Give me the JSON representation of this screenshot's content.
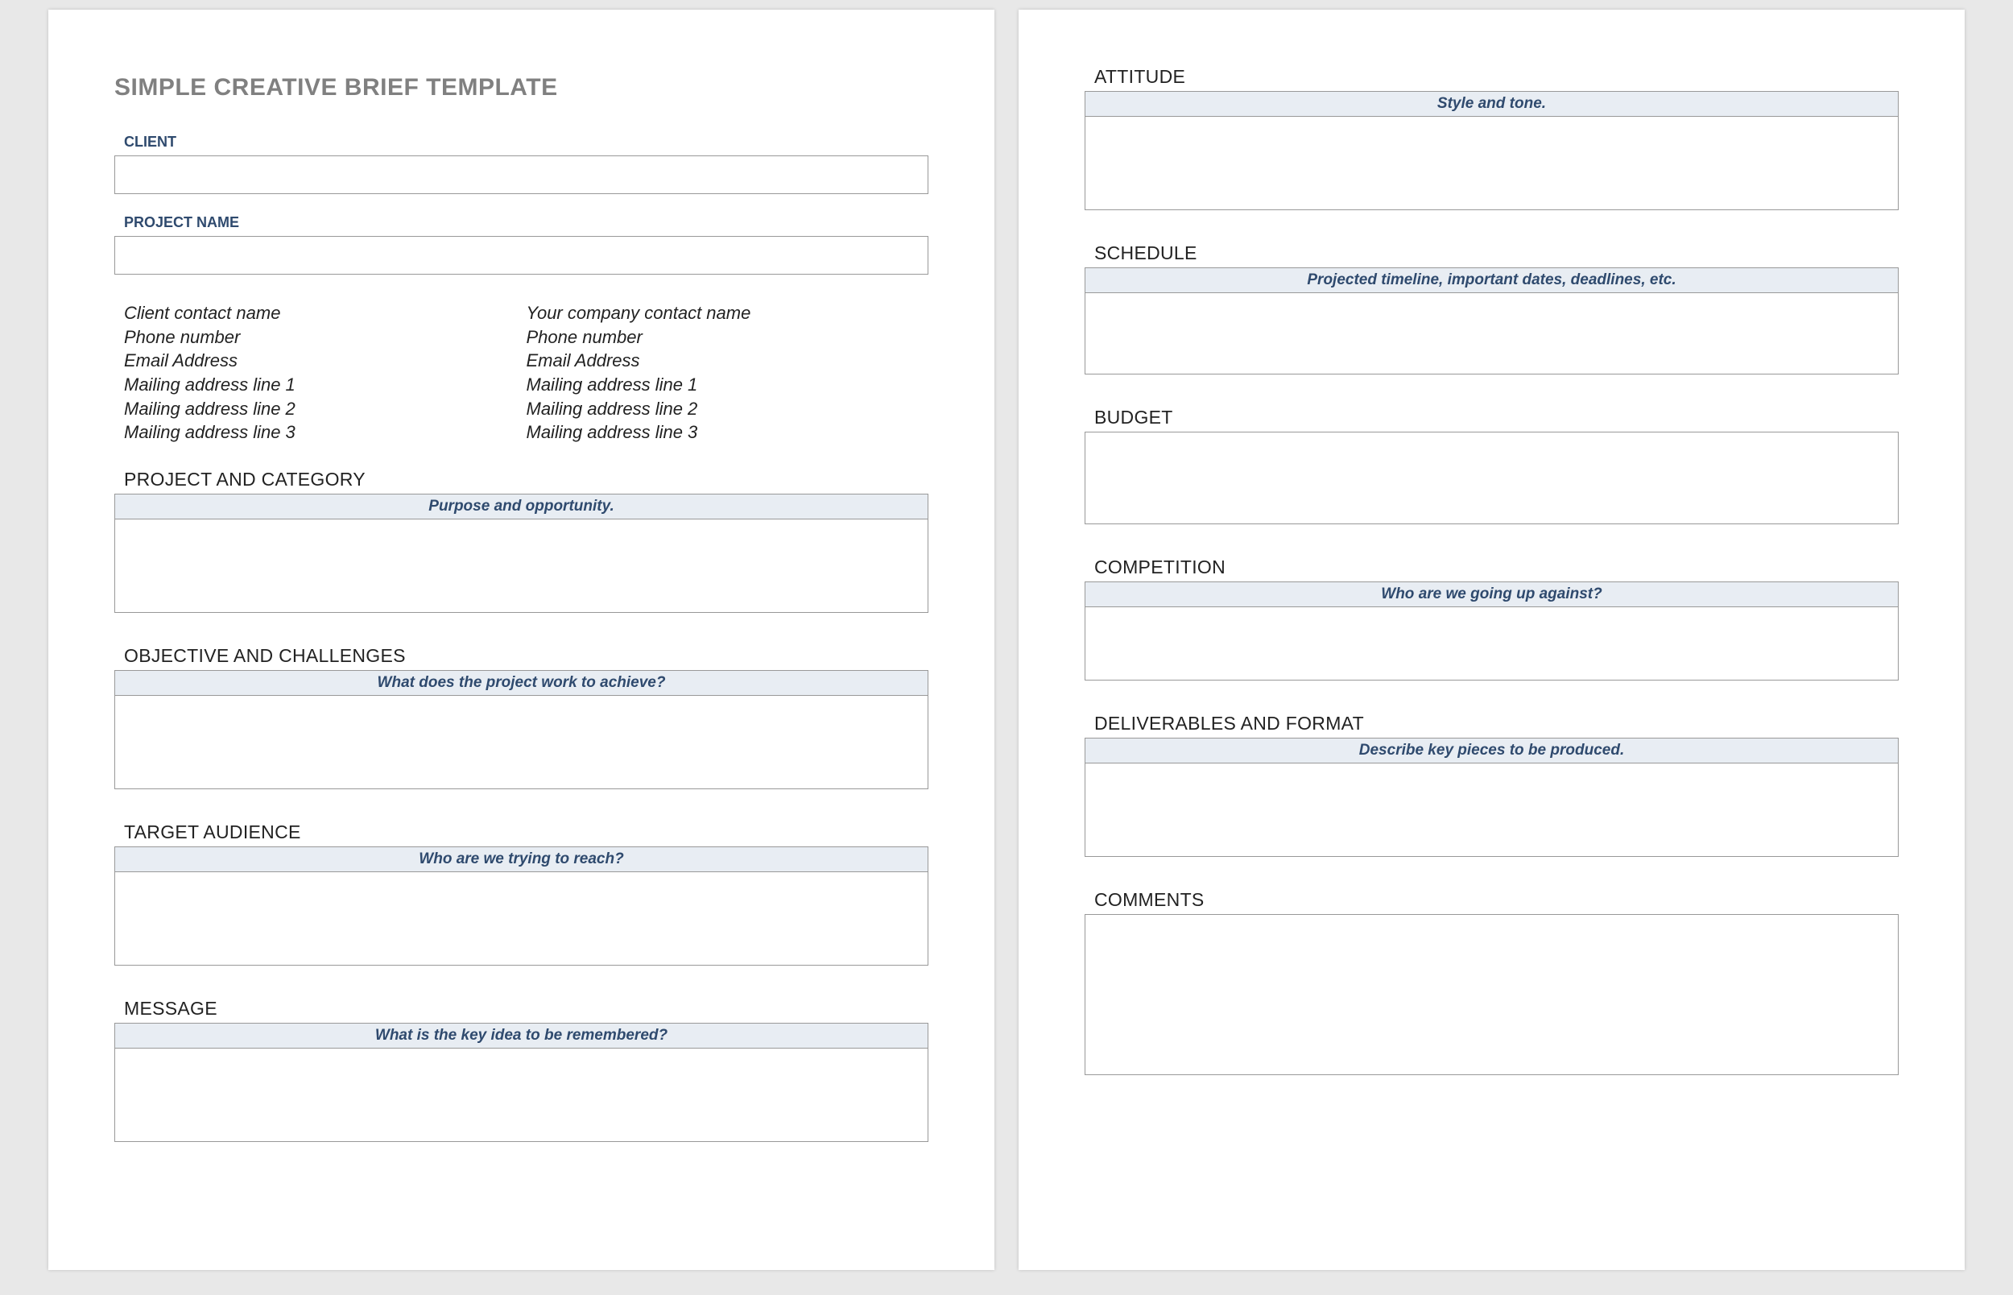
{
  "title": "SIMPLE CREATIVE BRIEF TEMPLATE",
  "labels": {
    "client": "CLIENT",
    "project_name": "PROJECT NAME"
  },
  "inputs": {
    "client": "",
    "project_name": ""
  },
  "contacts": {
    "client": {
      "name": "Client contact name",
      "phone": "Phone number",
      "email": "Email Address",
      "addr1": "Mailing address line 1",
      "addr2": "Mailing address line 2",
      "addr3": "Mailing address line 3"
    },
    "company": {
      "name": "Your company contact name",
      "phone": "Phone number",
      "email": "Email Address",
      "addr1": "Mailing address line 1",
      "addr2": "Mailing address line 2",
      "addr3": "Mailing address line 3"
    }
  },
  "sections": {
    "project_category": {
      "heading": "PROJECT AND CATEGORY",
      "hint": "Purpose and opportunity."
    },
    "objective": {
      "heading": "OBJECTIVE AND CHALLENGES",
      "hint": "What does the project work to achieve?"
    },
    "target": {
      "heading": "TARGET AUDIENCE",
      "hint": "Who are we trying to reach?"
    },
    "message": {
      "heading": "MESSAGE",
      "hint": "What is the key idea to be remembered?"
    },
    "attitude": {
      "heading": "ATTITUDE",
      "hint": "Style and tone."
    },
    "schedule": {
      "heading": "SCHEDULE",
      "hint": "Projected timeline, important dates, deadlines, etc."
    },
    "budget": {
      "heading": "BUDGET"
    },
    "competition": {
      "heading": "COMPETITION",
      "hint": "Who are we going up against?"
    },
    "deliverables": {
      "heading": "DELIVERABLES AND FORMAT",
      "hint": "Describe key pieces to be produced."
    },
    "comments": {
      "heading": "COMMENTS"
    }
  }
}
